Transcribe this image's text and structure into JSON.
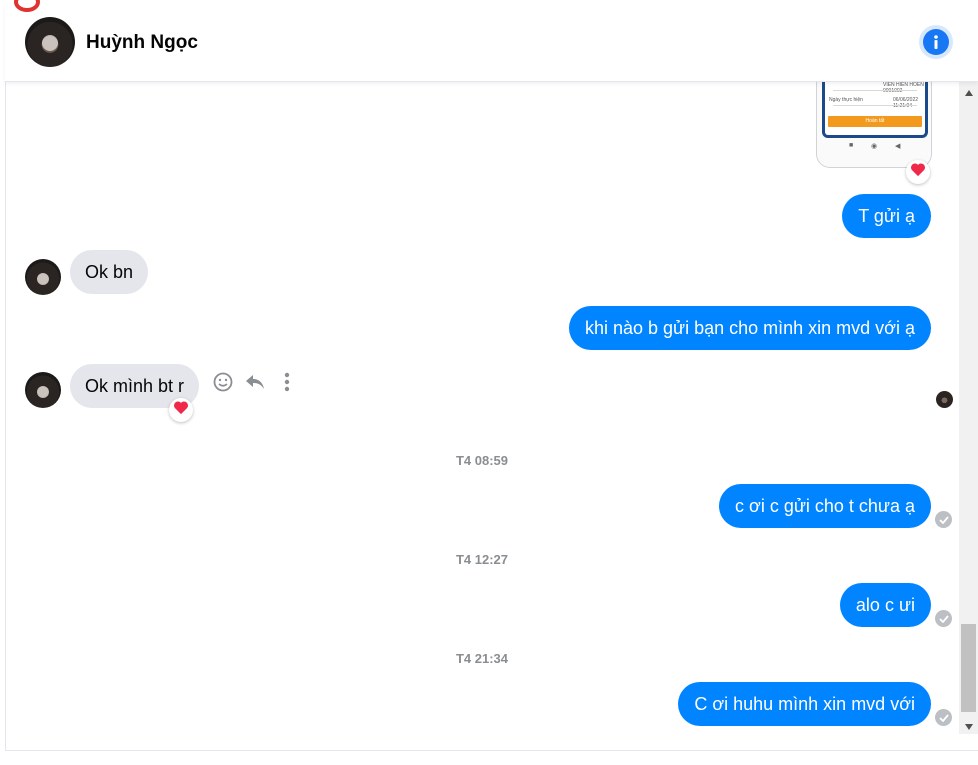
{
  "header": {
    "contact_name": "Huỳnh Ngọc",
    "info_icon": "info-icon"
  },
  "messages": {
    "sent_1": "T gửi ạ",
    "received_1": "Ok bn",
    "sent_2": "khi nào b gửi bạn cho mình xin mvd với ạ",
    "received_2": "Ok mình bt r",
    "timestamp_1": "T4 08:59",
    "sent_3": "c ơi c gửi cho t chưa ạ",
    "timestamp_2": "T4 12:27",
    "sent_4": "alo c ưi",
    "timestamp_3": "T4 21:34",
    "sent_5": "C ơi huhu mình xin mvd với"
  },
  "image_preview": {
    "line_1": "Ngày thực hiện",
    "line_1_value": "06/06/2022 11:21:04",
    "button": "Hoàn tất"
  },
  "reactions": {
    "heart_icon": "heart-icon"
  },
  "hover_actions": {
    "react_icon": "smiley-icon",
    "reply_icon": "reply-icon",
    "more_icon": "more-vertical-icon"
  },
  "colors": {
    "sent_bubble": "#0084ff",
    "received_bubble": "#e4e6eb",
    "accent": "#1877f2"
  }
}
